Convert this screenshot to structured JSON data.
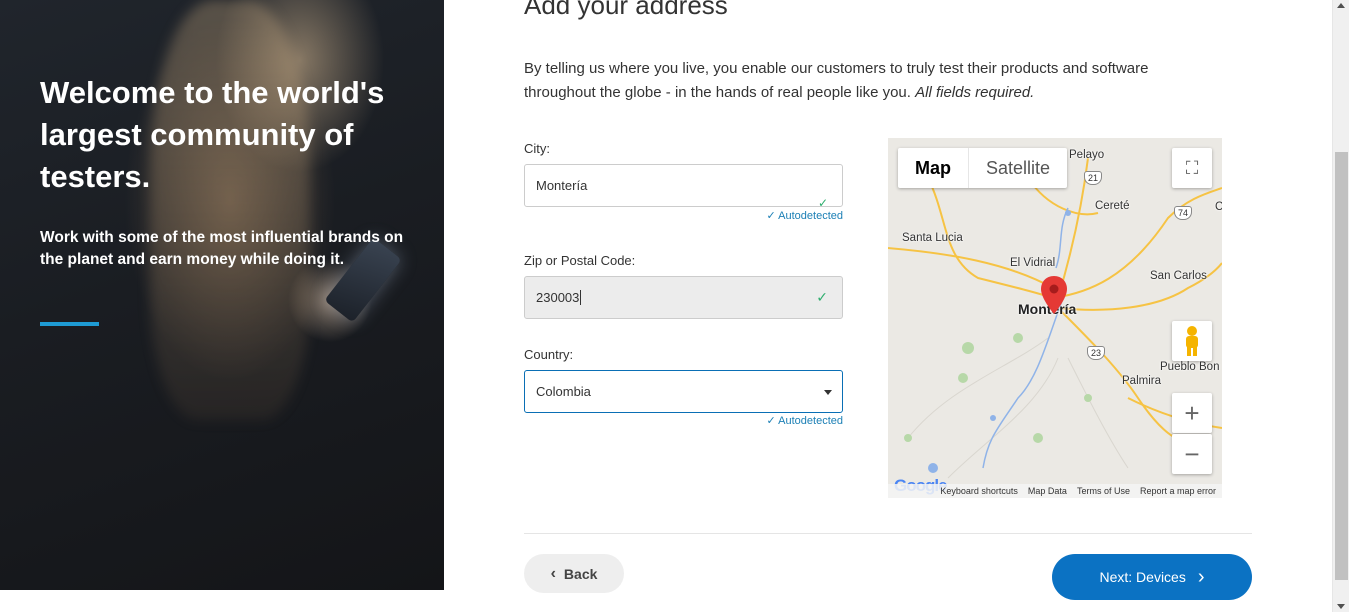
{
  "hero": {
    "title": "Welcome to the world's largest community of testers.",
    "subtitle": "Work with some of the most influential brands on the planet and earn money while doing it."
  },
  "form": {
    "heading": "Add your address",
    "intro": "By telling us where you live, you enable our customers to truly test their products and software throughout the globe - in the hands of real people like you.",
    "intro_emphasis": "All fields required.",
    "city": {
      "label": "City:",
      "value": "Montería",
      "status": "Autodetected"
    },
    "zip": {
      "label": "Zip or Postal Code:",
      "value": "230003"
    },
    "country": {
      "label": "Country:",
      "value": "Colombia",
      "status": "Autodetected"
    }
  },
  "map": {
    "tabs": {
      "map": "Map",
      "satellite": "Satellite"
    },
    "labels": {
      "pelayo": "Pelayo",
      "cerete": "Cereté",
      "santa_lucia": "Santa Lucia",
      "el_vidrial": "El Vidrial",
      "san_carlos": "San Carlos",
      "monteria": "Montería",
      "pueblo_bon": "Pueblo Bon",
      "palmira": "Palmira",
      "edge_c": "C"
    },
    "shields": {
      "r21": "21",
      "r74": "74",
      "r23": "23"
    },
    "google": "Google",
    "footer": {
      "shortcuts": "Keyboard shortcuts",
      "map_data": "Map Data",
      "terms": "Terms of Use",
      "report": "Report a map error"
    },
    "colors": {
      "marker": "#e53935",
      "road": "#f6c344",
      "water": "#8fb3e8"
    }
  },
  "nav": {
    "back": "Back",
    "next": "Next: Devices"
  },
  "colors": {
    "accent": "#0b72c3",
    "rule": "#1e9bd4",
    "check": "#2eae6e"
  }
}
